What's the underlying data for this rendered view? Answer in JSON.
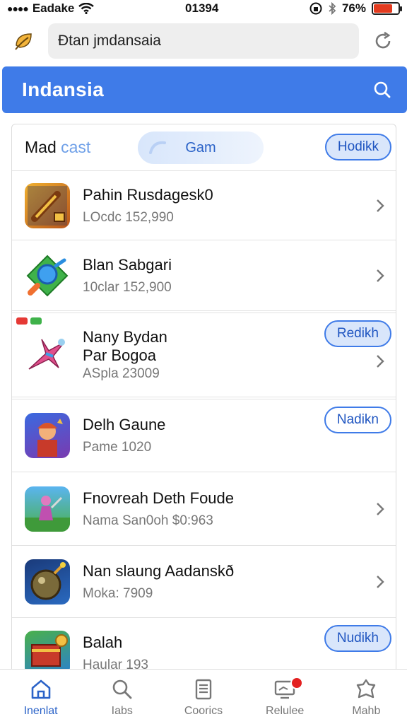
{
  "status_bar": {
    "carrier": "Eadake",
    "time": "01394",
    "battery_percent": "76%",
    "battery_level": 0.76
  },
  "browser": {
    "url": "Ɖtan jmdansaia"
  },
  "header": {
    "title": "Indansia"
  },
  "filter": {
    "label_main": "Mad",
    "label_accent": "cast",
    "tab_label": "Gam",
    "button_label": "Hodikk"
  },
  "apps": [
    {
      "title": "Pahin Rusdagesk0",
      "subtitle": "LOcdc 152,990"
    },
    {
      "title": "Blan Sabgari",
      "subtitle": "10clar 152,900"
    },
    {
      "title": "Nany Bydan",
      "title2": "Par Bogoa",
      "subtitle": "ASpla 23009",
      "button": "Redikh"
    },
    {
      "title": "Delh Gaune",
      "subtitle": "Pame 1020",
      "button": "Nadikn"
    },
    {
      "title": "Fnovreah Deth Foude",
      "subtitle": "Nama San0oh $0:963"
    },
    {
      "title": "Nan slaung Aadanskð",
      "subtitle": "Moka: 7909"
    },
    {
      "title": "Balah",
      "subtitle": "Haular 193",
      "button": "Nudikh"
    }
  ],
  "nav": [
    {
      "label": "Inenlat"
    },
    {
      "label": "Iabs"
    },
    {
      "label": "Coorics"
    },
    {
      "label": "Relulee"
    },
    {
      "label": "Mahb"
    }
  ],
  "colors": {
    "primary": "#3f7be8",
    "button_fill": "#d9e6fb",
    "badge": "#e32020",
    "battery": "#e33b1f"
  }
}
